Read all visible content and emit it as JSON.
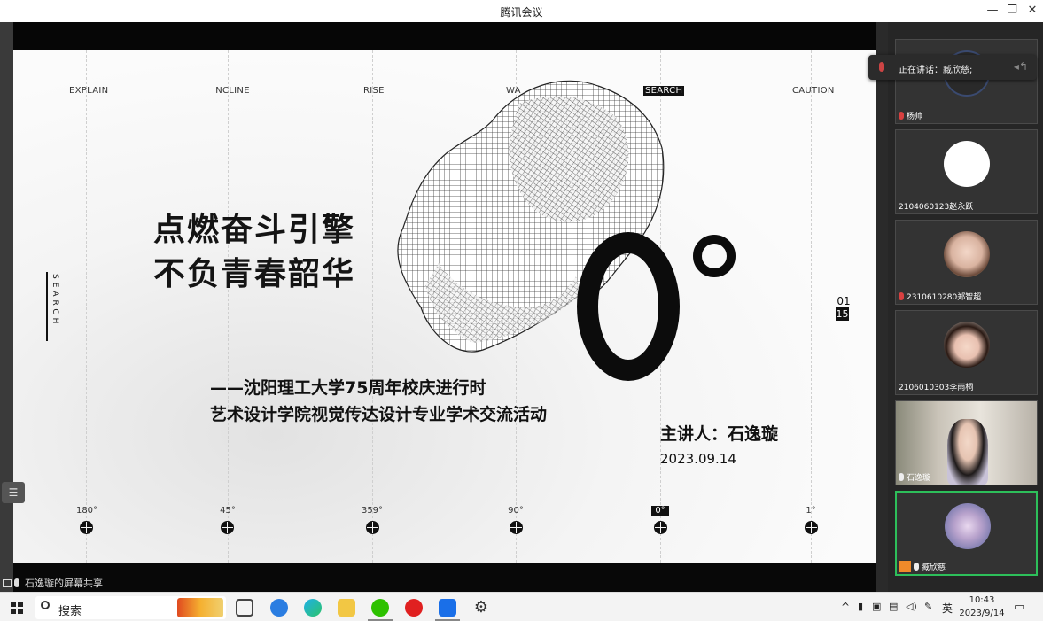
{
  "window": {
    "title": "腾讯会议",
    "controls": [
      "minimize-icon",
      "restore-icon",
      "close-icon"
    ]
  },
  "slide": {
    "top_labels": [
      "EXPLAIN",
      "INCLINE",
      "RISE",
      "WA",
      "SEARCH",
      "CAUTION"
    ],
    "vertical_label": "SEARCH",
    "headline": [
      "点燃奋斗引擎",
      "不负青春韶华"
    ],
    "page": {
      "total": "01",
      "current": "15"
    },
    "subtitle": [
      "——沈阳理工大学75周年校庆进行时",
      "艺术设计学院视觉传达设计专业学术交流活动"
    ],
    "speaker": "主讲人：石逸璇",
    "date": "2023.09.14",
    "degree_labels": [
      "180°",
      "45°",
      "359°",
      "90°",
      "0°",
      "1°"
    ]
  },
  "share_status": "石逸璇的屏幕共享",
  "speaking_now": "正在讲话：臧欣慈;",
  "participants": [
    {
      "name": "杨帅",
      "mic": "muted"
    },
    {
      "name": "2104060123赵永跃",
      "mic": "none"
    },
    {
      "name": "2310610280郑智超",
      "mic": "muted"
    },
    {
      "name": "2106010303李雨桐",
      "mic": "none"
    },
    {
      "name": "石逸璇",
      "mic": "on"
    },
    {
      "name": "臧欣慈",
      "mic": "on"
    }
  ],
  "taskbar": {
    "search_label": "搜索",
    "tray_ime": "英",
    "time": "10:43",
    "date": "2023/9/14"
  },
  "colors": {
    "active_border": "#2dbf5a",
    "muted_mic": "#d84040"
  }
}
